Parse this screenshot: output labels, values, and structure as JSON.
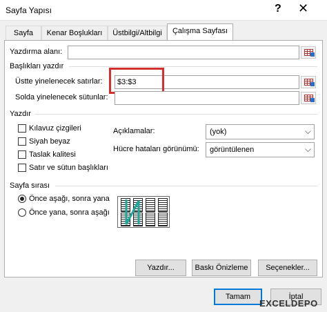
{
  "window": {
    "title": "Sayfa Yapısı",
    "help": "?",
    "close": "✕"
  },
  "tabs": [
    "Sayfa",
    "Kenar Boşlukları",
    "Üstbilgi/Altbilgi",
    "Çalışma Sayfası"
  ],
  "print_area": {
    "label": "Yazdırma alanı:",
    "value": ""
  },
  "print_titles": {
    "heading": "Başlıkları yazdır",
    "rows_label": "Üstte yinelenecek satırlar:",
    "rows_value": "$3:$3",
    "cols_label": "Solda yinelenecek sütunlar:",
    "cols_value": ""
  },
  "print": {
    "heading": "Yazdır",
    "checkboxes": [
      "Kılavuz çizgileri",
      "Siyah beyaz",
      "Taslak kalitesi",
      "Satır ve sütun başlıkları"
    ],
    "comments_label": "Açıklamalar:",
    "comments_value": "(yok)",
    "errors_label": "Hücre hataları görünümü:",
    "errors_value": "görüntülenen"
  },
  "page_order": {
    "heading": "Sayfa sırası",
    "options": [
      "Önce aşağı, sonra yana",
      "Önce yana, sonra aşağı"
    ],
    "selected": 0
  },
  "buttons": {
    "print": "Yazdır...",
    "preview": "Baskı Önizleme",
    "options": "Seçenekler...",
    "ok": "Tamam",
    "cancel": "İptal"
  },
  "watermark": "EXCELDEPO"
}
